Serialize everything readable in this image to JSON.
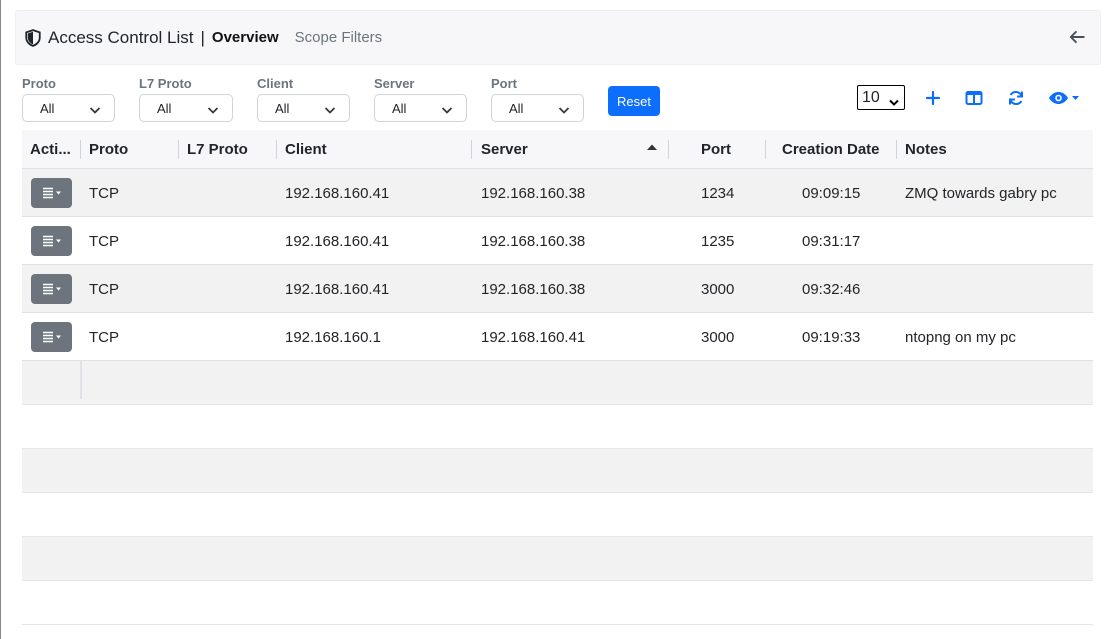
{
  "header": {
    "title": "Access Control List",
    "separator": "|",
    "tabs": [
      {
        "label": "Overview",
        "active": true
      },
      {
        "label": "Scope Filters",
        "active": false
      }
    ]
  },
  "filters": [
    {
      "label": "Proto",
      "value": "All"
    },
    {
      "label": "L7 Proto",
      "value": "All"
    },
    {
      "label": "Client",
      "value": "All"
    },
    {
      "label": "Server",
      "value": "All"
    },
    {
      "label": "Port",
      "value": "All"
    }
  ],
  "reset_label": "Reset",
  "page_size": "10",
  "icons": [
    "plus-icon",
    "columns-icon",
    "refresh-icon",
    "eye-icon"
  ],
  "colors": {
    "accent": "#0d6efd",
    "action_button": "#6c757d",
    "stripe": "#f2f2f2"
  },
  "table": {
    "columns": [
      "Acti...",
      "Proto",
      "L7 Proto",
      "Client",
      "Server",
      "Port",
      "Creation Date",
      "Notes"
    ],
    "sorted_column": "Server",
    "rows": [
      {
        "proto": "TCP",
        "l7": "",
        "client": "192.168.160.41",
        "server": "192.168.160.38",
        "port": "1234",
        "date": "09:09:15",
        "notes": "ZMQ towards gabry pc"
      },
      {
        "proto": "TCP",
        "l7": "",
        "client": "192.168.160.41",
        "server": "192.168.160.38",
        "port": "1235",
        "date": "09:31:17",
        "notes": ""
      },
      {
        "proto": "TCP",
        "l7": "",
        "client": "192.168.160.41",
        "server": "192.168.160.38",
        "port": "3000",
        "date": "09:32:46",
        "notes": ""
      },
      {
        "proto": "TCP",
        "l7": "",
        "client": "192.168.160.1",
        "server": "192.168.160.41",
        "port": "3000",
        "date": "09:19:33",
        "notes": "ntopng on my pc"
      }
    ]
  }
}
